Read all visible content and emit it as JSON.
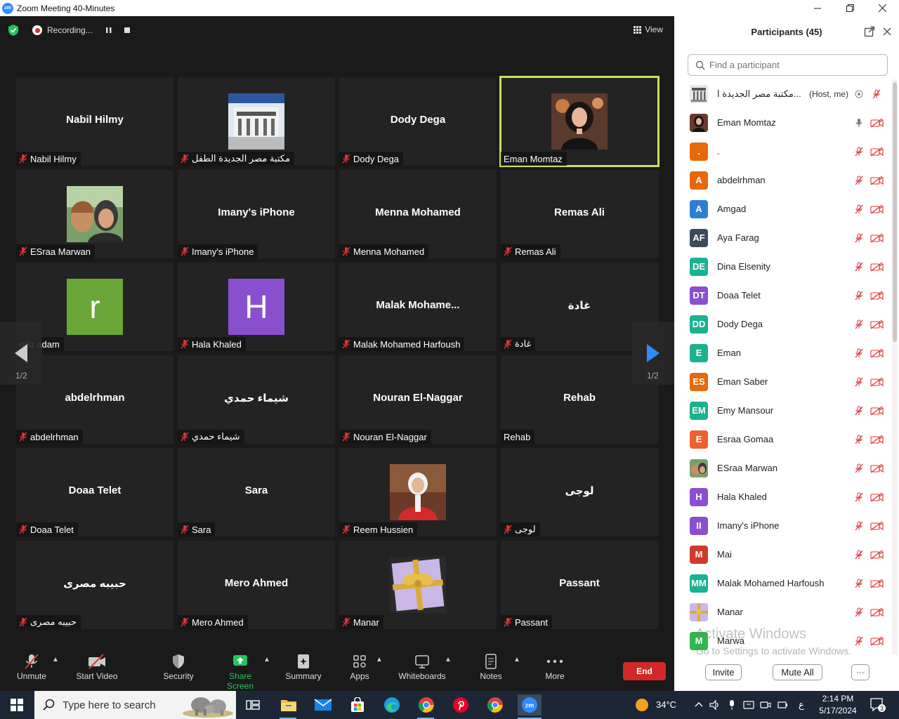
{
  "window": {
    "title": "Zoom Meeting 40-Minutes",
    "app_badge": "zm"
  },
  "top_bar": {
    "recording_label": "Recording...",
    "view_label": "View"
  },
  "gallery": {
    "page_indicator_left": "1/2",
    "page_indicator_right": "1/2",
    "tiles": [
      {
        "display": "Nabil Hilmy",
        "tag": "Nabil Hilmy",
        "muted": true,
        "kind": "name"
      },
      {
        "display": "",
        "tag": "مكتبة مصر الجديدة الطفل",
        "muted": true,
        "kind": "photo-library"
      },
      {
        "display": "Dody Dega",
        "tag": "Dody Dega",
        "muted": true,
        "kind": "name"
      },
      {
        "display": "",
        "tag": "Eman Momtaz",
        "muted": false,
        "kind": "photo-eman",
        "active": true
      },
      {
        "display": "",
        "tag": "ESraa Marwan",
        "muted": true,
        "kind": "photo-esraa"
      },
      {
        "display": "Imany's iPhone",
        "tag": "Imany's iPhone",
        "muted": true,
        "kind": "name"
      },
      {
        "display": "Menna Mohamed",
        "tag": "Menna Mohamed",
        "muted": true,
        "kind": "name"
      },
      {
        "display": "Remas Ali",
        "tag": "Remas Ali",
        "muted": true,
        "kind": "name"
      },
      {
        "display": "r",
        "tag": "nda adam",
        "muted": false,
        "kind": "letter",
        "color": "#6aa637"
      },
      {
        "display": "H",
        "tag": "Hala Khaled",
        "muted": true,
        "kind": "letter",
        "color": "#8a4fcf"
      },
      {
        "display": "Malak  Mohame...",
        "tag": "Malak Mohamed Harfoush",
        "muted": true,
        "kind": "name"
      },
      {
        "display": "غادة",
        "tag": "غادة",
        "muted": true,
        "kind": "name"
      },
      {
        "display": "abdelrhman",
        "tag": "abdelrhman",
        "muted": true,
        "kind": "name"
      },
      {
        "display": "شيماء حمدي",
        "tag": "شيماء حمدي",
        "muted": true,
        "kind": "name"
      },
      {
        "display": "Nouran El-Naggar",
        "tag": "Nouran El-Naggar",
        "muted": true,
        "kind": "name"
      },
      {
        "display": "Rehab",
        "tag": "Rehab",
        "muted": false,
        "kind": "name"
      },
      {
        "display": "Doaa Telet",
        "tag": "Doaa Telet",
        "muted": true,
        "kind": "name"
      },
      {
        "display": "Sara",
        "tag": "Sara",
        "muted": true,
        "kind": "name"
      },
      {
        "display": "",
        "tag": "Reem Hussien",
        "muted": true,
        "kind": "photo-reem"
      },
      {
        "display": "لوجى",
        "tag": "لوجى",
        "muted": true,
        "kind": "name"
      },
      {
        "display": "حبيبه مصرى",
        "tag": "حبيبه مصرى",
        "muted": true,
        "kind": "name"
      },
      {
        "display": "Mero Ahmed",
        "tag": "Mero Ahmed",
        "muted": true,
        "kind": "name"
      },
      {
        "display": "",
        "tag": "Manar",
        "muted": true,
        "kind": "photo-gift"
      },
      {
        "display": "Passant",
        "tag": "Passant",
        "muted": true,
        "kind": "name"
      }
    ]
  },
  "toolbar": {
    "unmute": "Unmute",
    "start_video": "Start Video",
    "security": "Security",
    "share_screen": "Share Screen",
    "summary": "Summary",
    "apps": "Apps",
    "whiteboards": "Whiteboards",
    "notes": "Notes",
    "more": "More",
    "end": "End"
  },
  "participants_panel": {
    "title": "Participants (45)",
    "search_placeholder": "Find a participant",
    "participants": [
      {
        "name": "مكتبة مصر الجديدة ا...",
        "tag": "(Host, me)",
        "avatar": "img-library",
        "color": "#7a7a7a",
        "mic": "muted",
        "host": true
      },
      {
        "name": "Eman Momtaz",
        "tag": "",
        "avatar": "img-eman",
        "color": "#6a3a2a",
        "mic": "on"
      },
      {
        "name": ".",
        "tag": "",
        "avatar": "letter",
        "initials": ".",
        "color": "#e8680c",
        "mic": "muted"
      },
      {
        "name": "abdelrhman",
        "tag": "",
        "avatar": "letter",
        "initials": "A",
        "color": "#e8680c",
        "mic": "muted"
      },
      {
        "name": "Amgad",
        "tag": "",
        "avatar": "letter",
        "initials": "A",
        "color": "#2d7fd3",
        "mic": "muted"
      },
      {
        "name": "Aya Farag",
        "tag": "",
        "avatar": "letter",
        "initials": "AF",
        "color": "#3c4a5c",
        "mic": "muted"
      },
      {
        "name": "Dina Elsenity",
        "tag": "",
        "avatar": "letter",
        "initials": "DE",
        "color": "#1bb28f",
        "mic": "muted"
      },
      {
        "name": "Doaa Telet",
        "tag": "",
        "avatar": "letter",
        "initials": "DT",
        "color": "#8a4fcf",
        "mic": "muted"
      },
      {
        "name": "Dody Dega",
        "tag": "",
        "avatar": "letter",
        "initials": "DD",
        "color": "#1bb28f",
        "mic": "muted"
      },
      {
        "name": "Eman",
        "tag": "",
        "avatar": "letter",
        "initials": "E",
        "color": "#1bb28f",
        "mic": "muted"
      },
      {
        "name": "Eman Saber",
        "tag": "",
        "avatar": "letter",
        "initials": "ES",
        "color": "#e8680c",
        "mic": "muted"
      },
      {
        "name": "Emy Mansour",
        "tag": "",
        "avatar": "letter",
        "initials": "EM",
        "color": "#1bb28f",
        "mic": "muted"
      },
      {
        "name": "Esraa Gomaa",
        "tag": "",
        "avatar": "letter",
        "initials": "E",
        "color": "#f0602c",
        "mic": "muted"
      },
      {
        "name": "ESraa Marwan",
        "tag": "",
        "avatar": "img-esraa",
        "color": "#8a6a4a",
        "mic": "muted"
      },
      {
        "name": "Hala Khaled",
        "tag": "",
        "avatar": "letter",
        "initials": "H",
        "color": "#8a4fcf",
        "mic": "muted"
      },
      {
        "name": "Imany's iPhone",
        "tag": "",
        "avatar": "letter",
        "initials": "II",
        "color": "#8a4fcf",
        "mic": "muted"
      },
      {
        "name": "Mai",
        "tag": "",
        "avatar": "letter",
        "initials": "M",
        "color": "#d03a2a",
        "mic": "muted"
      },
      {
        "name": "Malak Mohamed Harfoush",
        "tag": "",
        "avatar": "letter",
        "initials": "MM",
        "color": "#1bb28f",
        "mic": "muted"
      },
      {
        "name": "Manar",
        "tag": "",
        "avatar": "img-gift",
        "color": "#c9b8e6",
        "mic": "muted"
      },
      {
        "name": "Marwa",
        "tag": "",
        "avatar": "letter",
        "initials": "M",
        "color": "#2fb84f",
        "mic": "muted"
      }
    ],
    "watermark_line1": "Activate Windows",
    "watermark_line2": "Go to Settings to activate Windows.",
    "invite": "Invite",
    "mute_all": "Mute All",
    "more": "···"
  },
  "taskbar": {
    "search_placeholder": "Type here to search",
    "weather": "34°C",
    "time": "2:14 PM",
    "date": "5/17/2024",
    "lang": "ع",
    "notif_count": "3"
  },
  "colors": {
    "accent_green": "#23c55e",
    "active_speaker": "#c4e35a",
    "end_red": "#d32828",
    "meeting_bg": "#1a1a1a"
  }
}
